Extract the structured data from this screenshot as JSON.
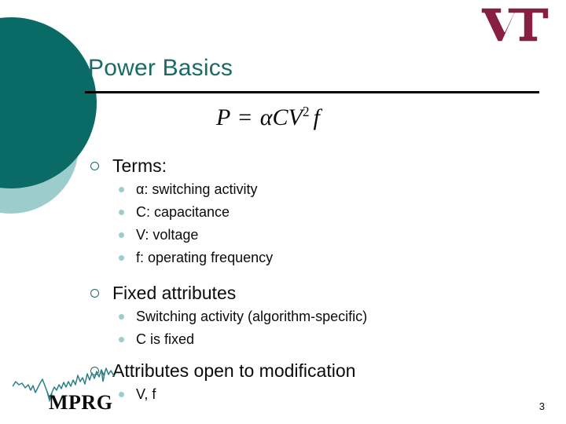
{
  "slide": {
    "title": "Power Basics",
    "page_number": "3",
    "colors": {
      "title_teal": "#1a6b66",
      "circle_dark": "#0a6b66",
      "circle_light": "#9ccdcc",
      "vt_maroon": "#861f41",
      "bullet_dot": "#9ccdcc",
      "rule": "#000000",
      "text": "#0b0b0b"
    }
  },
  "equation": {
    "lhs": "P",
    "operator": "=",
    "alpha": "α",
    "capacitance": "C",
    "voltage": "V",
    "exponent": "2",
    "frequency": "f",
    "plain": "P = αCV²f"
  },
  "content": {
    "sections": [
      {
        "heading": "Terms:",
        "items": [
          "α: switching activity",
          "C: capacitance",
          "V: voltage",
          "f: operating frequency"
        ]
      },
      {
        "heading": "Fixed attributes",
        "items": [
          "Switching activity (algorithm-specific)",
          "C is fixed"
        ]
      },
      {
        "heading": "Attributes open to modification",
        "items": [
          "V, f"
        ]
      }
    ]
  },
  "logos": {
    "vt": "VT",
    "mprg": "MPRG"
  }
}
